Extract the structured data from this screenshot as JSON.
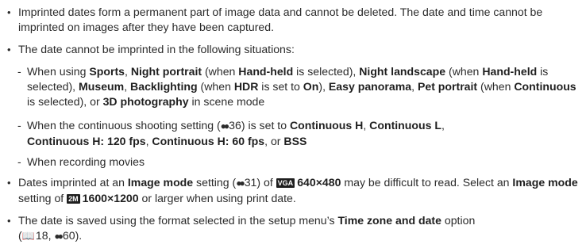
{
  "bullet_glyph": "•",
  "dash_glyph": "-",
  "icons": {
    "reference": "page-reference-icon",
    "manual": "manual-page-icon"
  },
  "item1": {
    "text": "Imprinted dates form a permanent part of image data and cannot be deleted. The date and time cannot be imprinted on images after they have been captured."
  },
  "item2": {
    "text": "The date cannot be imprinted in the following situations:",
    "sub1": {
      "t1": "When using ",
      "b1": "Sports",
      "t2": ", ",
      "b2": "Night portrait",
      "t3": " (when ",
      "b3": "Hand-held",
      "t4": " is selected), ",
      "b4": "Night landscape",
      "t5": " (when ",
      "b5": "Hand-held",
      "t6": " is selected), ",
      "b6": "Museum",
      "t7": ", ",
      "b7": "Backlighting",
      "t8": " (when ",
      "b8": "HDR",
      "t9": " is set to ",
      "b9": "On",
      "t10": "), ",
      "b10": "Easy panorama",
      "t11": ", ",
      "b11": "Pet portrait",
      "t12": " (when ",
      "b12": "Continuous",
      "t13": " is selected), or ",
      "b13": "3D photography",
      "t14": " in scene mode"
    },
    "sub2": {
      "t1": "When the continuous shooting setting (",
      "ref": "36",
      "t2": ") is set to ",
      "b1": "Continuous H",
      "t3": ", ",
      "b2": "Continuous L",
      "t4": ", ",
      "b3": "Continuous H: 120 fps",
      "t5": ", ",
      "b4": "Continuous H: 60 fps",
      "t6": ", or ",
      "b5": "BSS"
    },
    "sub3": {
      "text": "When recording movies"
    }
  },
  "item3": {
    "t1": "Dates imprinted at an ",
    "b1": "Image mode",
    "t2": " setting (",
    "ref": "31",
    "t3": ") of ",
    "badge1": "VGA",
    "b2": "640×480",
    "t4": " may be difficult to read. Select an ",
    "b3": "Image mode",
    "t5": " setting of ",
    "badge2": "2M",
    "b4": "1600×1200",
    "t6": " or larger when using print date."
  },
  "item4": {
    "t1": "The date is saved using the format selected in the setup menu’s ",
    "b1": "Time zone and date",
    "t2": " option",
    "t3": "(",
    "ref1": "18",
    "t4": ", ",
    "ref2": "60",
    "t5": ")."
  }
}
